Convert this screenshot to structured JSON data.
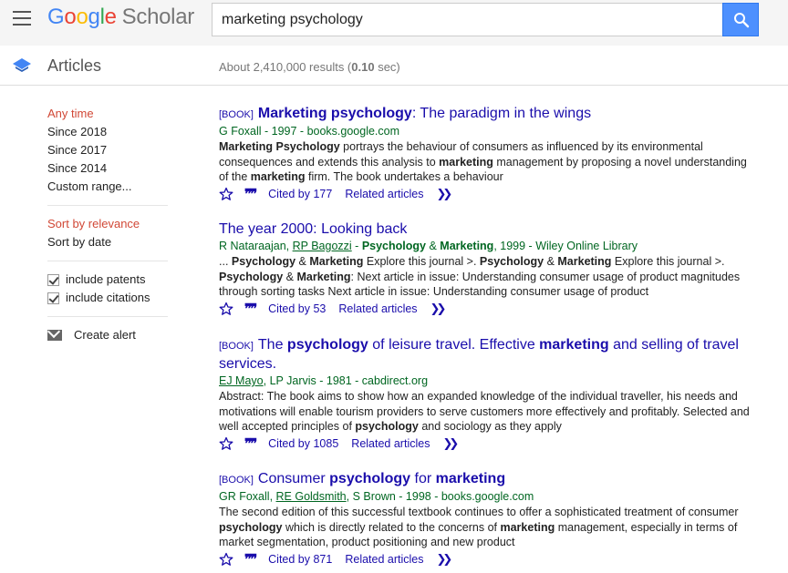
{
  "header": {
    "logo_google": [
      "G",
      "o",
      "o",
      "g",
      "l",
      "e"
    ],
    "logo_scholar": "Scholar",
    "search_value": "marketing psychology"
  },
  "subheader": {
    "title": "Articles",
    "results_prefix": "About 2,410,000 results (",
    "results_time": "0.10",
    "results_suffix": " sec)"
  },
  "sidebar": {
    "time_filters": [
      "Any time",
      "Since 2018",
      "Since 2017",
      "Since 2014",
      "Custom range..."
    ],
    "sort_options": [
      "Sort by relevance",
      "Sort by date"
    ],
    "checkboxes": [
      "include patents",
      "include citations"
    ],
    "create_alert": "Create alert"
  },
  "results": [
    {
      "tag": "[BOOK]",
      "title_html": "<b>Marketing psychology</b>: The paradigm in the wings",
      "meta_html": "G Foxall - 1997 - books.google.com",
      "snippet_html": "<b>Marketing Psychology</b> portrays the behaviour of consumers as influenced by its environmental consequences and extends this analysis to <b>marketing</b> management by proposing a novel understanding of the <b>marketing</b> firm. The book undertakes a behaviour",
      "cited_by": "Cited by 177",
      "related": "Related articles"
    },
    {
      "tag": "",
      "title_html": "The year 2000: Looking back",
      "meta_html": "R Nataraajan, <span class=\"u\">RP Bagozzi</span> - <b>Psychology</b> &amp; <b>Marketing</b>, 1999 - Wiley Online Library",
      "snippet_html": "... <b>Psychology</b> &amp; <b>Marketing</b> Explore this journal &gt;. <b>Psychology</b> &amp; <b>Marketing</b> Explore this journal &gt;. <b>Psychology</b> &amp; <b>Marketing</b>: Next article in issue: Understanding consumer usage of product magnitudes through sorting tasks Next article in issue: Understanding consumer usage of product",
      "cited_by": "Cited by 53",
      "related": "Related articles"
    },
    {
      "tag": "[BOOK]",
      "title_html": "The <b>psychology</b> of leisure travel. Effective <b>marketing</b> and selling of travel services.",
      "meta_html": "<span class=\"u\">EJ Mayo</span>, LP Jarvis - 1981 - cabdirect.org",
      "snippet_html": "Abstract: The book aims to show how an expanded knowledge of the individual traveller, his needs and motivations will enable tourism providers to serve customers more effectively and profitably. Selected and well accepted principles of <b>psychology</b> and sociology as they apply",
      "cited_by": "Cited by 1085",
      "related": "Related articles"
    },
    {
      "tag": "[BOOK]",
      "title_html": "Consumer <b>psychology</b> for <b>marketing</b>",
      "meta_html": "GR Foxall, <span class=\"u\">RE Goldsmith</span>, S Brown - 1998 - books.google.com",
      "snippet_html": "The second edition of this successful textbook continues to offer a sophisticated treatment of consumer <b>psychology</b> which is directly related to the concerns of <b>marketing</b> management, especially in terms of market segmentation, product positioning and new product",
      "cited_by": "Cited by 871",
      "related": "Related articles"
    }
  ]
}
